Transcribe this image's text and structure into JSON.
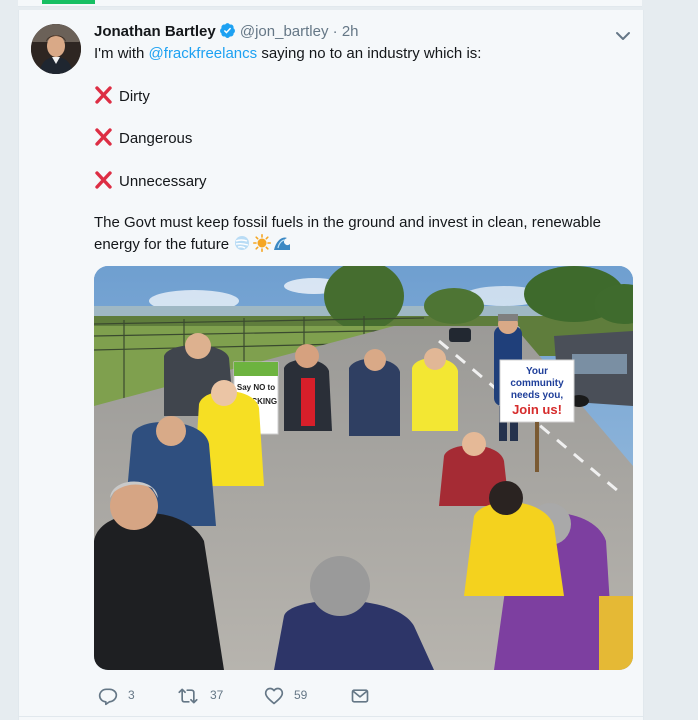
{
  "tweet": {
    "author_name": "Jonathan Bartley",
    "handle": "@jon_bartley",
    "separator": "·",
    "time": "2h",
    "intro_prefix": "I'm with ",
    "intro_mention": "@frackfreelancs",
    "intro_suffix": " saying no to an industry which is:",
    "items": [
      "Dirty",
      "Dangerous",
      "Unnecessary"
    ],
    "body_line1": "The Govt must keep fossil fuels in the ground and invest in clean, renewable",
    "body_line2": "energy for the future",
    "emoji_icons": [
      "wind-face-icon",
      "sun-icon",
      "wave-icon"
    ],
    "image": {
      "sign_left_line1": "Say NO to",
      "sign_left_line2": "FRACKING",
      "sign_right_line1": "Your",
      "sign_right_line2": "community",
      "sign_right_line3": "needs you,",
      "sign_right_line4": "Join us!"
    },
    "actions": {
      "reply_count": "3",
      "retweet_count": "37",
      "like_count": "59"
    }
  },
  "colors": {
    "accent_blue": "#1da1f2",
    "accent_green": "#17bf63",
    "cross_red": "#dd2e44",
    "text_dark": "#14171a",
    "text_muted": "#657786"
  }
}
